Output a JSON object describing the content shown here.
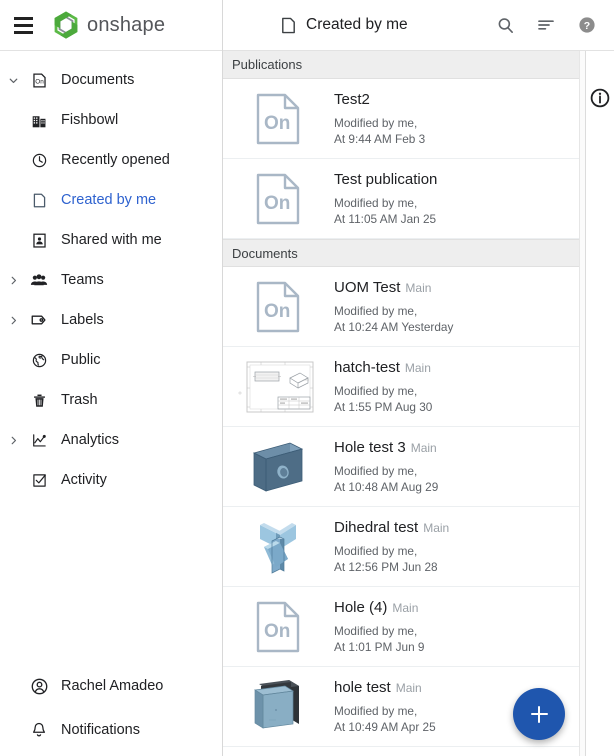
{
  "brand": {
    "name": "onshape",
    "logo_icon": "onshape-logo-icon",
    "menu_icon": "hamburger-menu-icon",
    "green": "#5bb946",
    "green_dark": "#3f9e33",
    "gray": "#54565a"
  },
  "sidebar": {
    "items": [
      {
        "label": "Documents",
        "icon": "onshape-document-icon",
        "caret": "chevron-down",
        "indent": 0,
        "active": false
      },
      {
        "label": "Fishbowl",
        "icon": "building-icon",
        "caret": "",
        "indent": 1,
        "active": false
      },
      {
        "label": "Recently opened",
        "icon": "clock-icon",
        "caret": "",
        "indent": 1,
        "active": false
      },
      {
        "label": "Created by me",
        "icon": "document-page-icon",
        "caret": "",
        "indent": 1,
        "active": true
      },
      {
        "label": "Shared with me",
        "icon": "shared-person-icon",
        "caret": "",
        "indent": 1,
        "active": false
      },
      {
        "label": "Teams",
        "icon": "people-group-icon",
        "caret": "chevron-right",
        "indent": 0,
        "active": false
      },
      {
        "label": "Labels",
        "icon": "label-tag-icon",
        "caret": "chevron-right",
        "indent": 0,
        "active": false
      },
      {
        "label": "Public",
        "icon": "globe-icon",
        "caret": "",
        "indent": 1,
        "active": false
      },
      {
        "label": "Trash",
        "icon": "trash-icon",
        "caret": "",
        "indent": 1,
        "active": false
      },
      {
        "label": "Analytics",
        "icon": "analytics-chart-icon",
        "caret": "chevron-right",
        "indent": 0,
        "active": false
      },
      {
        "label": "Activity",
        "icon": "checkbox-icon",
        "caret": "",
        "indent": 1,
        "active": false
      }
    ],
    "bottom_items": [
      {
        "label": "Rachel Amadeo",
        "icon": "user-avatar-icon"
      },
      {
        "label": "Notifications",
        "icon": "bell-icon"
      }
    ],
    "active_color": "#2e62cf"
  },
  "topbar": {
    "title": "Created by me",
    "title_icon": "document-page-icon",
    "actions": [
      {
        "name": "search-icon",
        "label": "Search"
      },
      {
        "name": "sort-filter-icon",
        "label": "Sort"
      },
      {
        "name": "help-icon",
        "label": "Help"
      }
    ]
  },
  "right_rail": {
    "info_icon": "info-circle-icon"
  },
  "fab": {
    "label": "+",
    "name": "create-new-button",
    "color": "#1f56ae"
  },
  "sections": [
    {
      "header": "Publications",
      "rows": [
        {
          "title": "Test2",
          "branch": "",
          "modified_by": "Modified by me,",
          "modified_at": "At 9:44 AM Feb 3",
          "thumb": "on-placeholder"
        },
        {
          "title": "Test publication",
          "branch": "",
          "modified_by": "Modified by me,",
          "modified_at": "At 11:05 AM Jan 25",
          "thumb": "on-placeholder"
        }
      ]
    },
    {
      "header": "Documents",
      "rows": [
        {
          "title": "UOM Test",
          "branch": "Main",
          "modified_by": "Modified by me,",
          "modified_at": "At 10:24 AM Yesterday",
          "thumb": "on-placeholder"
        },
        {
          "title": "hatch-test",
          "branch": "Main",
          "modified_by": "Modified by me,",
          "modified_at": "At 1:55 PM Aug 30",
          "thumb": "drawing-sheet"
        },
        {
          "title": "Hole test 3",
          "branch": "Main",
          "modified_by": "Modified by me,",
          "modified_at": "At 10:48 AM Aug 29",
          "thumb": "plate-with-hole"
        },
        {
          "title": "Dihedral test",
          "branch": "Main",
          "modified_by": "Modified by me,",
          "modified_at": "At 12:56 PM Jun 28",
          "thumb": "dihedral-part"
        },
        {
          "title": "Hole (4)",
          "branch": "Main",
          "modified_by": "Modified by me,",
          "modified_at": "At 1:01 PM Jun 9",
          "thumb": "on-placeholder"
        },
        {
          "title": "hole test",
          "branch": "Main",
          "modified_by": "Modified by me,",
          "modified_at": "At 10:49 AM Apr 25",
          "thumb": "box-assembly"
        }
      ]
    }
  ]
}
